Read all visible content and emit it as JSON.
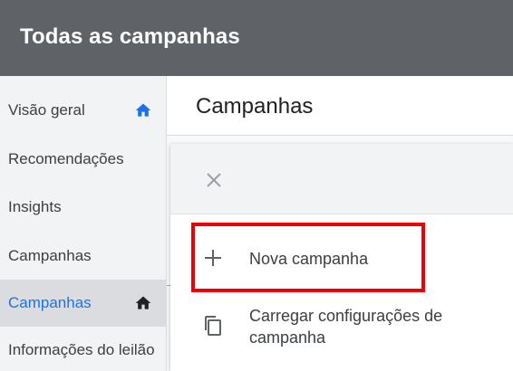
{
  "header": {
    "title": "Todas as campanhas"
  },
  "sidebar": {
    "items": [
      {
        "label": "Visão geral",
        "icon": "home-icon",
        "icon_color": "#1a73e8"
      },
      {
        "label": "Recomendações"
      },
      {
        "label": "Insights"
      },
      {
        "label": "Campanhas"
      },
      {
        "label": "Campanhas",
        "icon": "home-icon",
        "icon_color": "#202124",
        "active": true
      },
      {
        "label": "Informações do leilão"
      }
    ]
  },
  "main": {
    "title": "Campanhas"
  },
  "menu": {
    "close_icon": "close-icon",
    "options": [
      {
        "label": "Nova campanha",
        "icon": "plus-icon"
      },
      {
        "label": "Carregar configurações de campanha",
        "icon": "copy-icon"
      }
    ]
  },
  "colors": {
    "topbar": "#5f6368",
    "accent": "#1a73e8",
    "highlight": "#e8000b"
  }
}
